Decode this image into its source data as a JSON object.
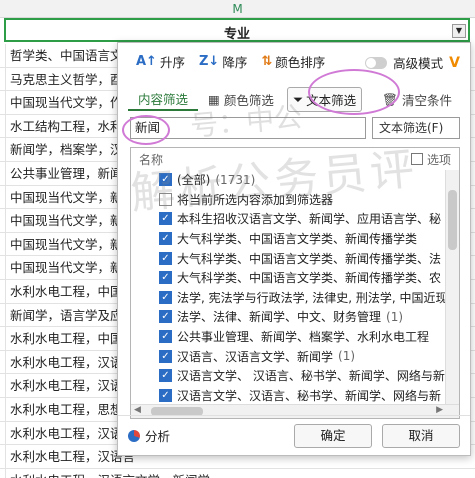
{
  "sheet": {
    "column_letter": "M",
    "header": "专业",
    "rows": [
      "哲学类、中国语言文",
      "马克思主义哲学，酉",
      "中国现当代文学，作",
      "水工结构工程，水利",
      "新闻学，档案学，汉",
      "公共事业管理，新闻",
      "中国现当代文学，新",
      "中国现当代文学，新",
      "中国现当代文学，新",
      "中国现当代文学，新",
      "水利水电工程，中国",
      "新闻学，语言学及应",
      "水利水电工程，中国",
      "水利水电工程，汉语",
      "水利水电工程，汉语",
      "水利水电工程，思想",
      "水利水电工程，汉语",
      "水利水电工程，汉语言",
      "水利水电工程，汉语言文学，新闻学"
    ]
  },
  "watermark": {
    "line1": "号：中公",
    "line2": "解析公务员评"
  },
  "toolbar": {
    "asc": "升序",
    "desc": "降序",
    "color_sort": "颜色排序",
    "advanced": "高级模式"
  },
  "tabs": {
    "content": "内容筛选",
    "color": "颜色筛选",
    "text_filter": "文本筛选",
    "clear": "清空条件"
  },
  "search": {
    "value": "新闻",
    "mode": "文本筛选(F)"
  },
  "list": {
    "header_name": "名称",
    "header_option": "选项",
    "items": [
      {
        "label": "(全部)",
        "count": "(1731)",
        "checked": true
      },
      {
        "label": "将当前所选内容添加到筛选器",
        "count": "",
        "checked": false
      },
      {
        "label": "本科生招收汉语言文学、新闻学、应用语言学、秘",
        "count": "",
        "checked": true
      },
      {
        "label": "大气科学类、中国语言文学类、新闻传播学类",
        "count": "",
        "checked": true
      },
      {
        "label": "大气科学类、中国语言文学类、新闻传播学类、法",
        "count": "",
        "checked": true
      },
      {
        "label": "大气科学类、中国语言文学类、新闻传播学类、农",
        "count": "",
        "checked": true
      },
      {
        "label": "法学, 宪法学与行政法学, 法律史, 刑法学, 中国近现",
        "count": "",
        "checked": true
      },
      {
        "label": "法学、法律、新闻学、中文、财务管理",
        "count": "(1)",
        "checked": true
      },
      {
        "label": "公共事业管理、新闻学、档案学、水利水电工程",
        "count": "",
        "checked": true
      },
      {
        "label": "汉语言、汉语言文学、新闻学",
        "count": "(1)",
        "checked": true
      },
      {
        "label": "汉语言文学、 汉语言、秘书学、新闻学、网络与新",
        "count": "",
        "checked": true
      },
      {
        "label": "汉语言文学、汉语言、秘书学、新闻学、网络与新",
        "count": "",
        "checked": true
      }
    ]
  },
  "footer": {
    "analysis": "分析",
    "ok": "确定",
    "cancel": "取消"
  }
}
